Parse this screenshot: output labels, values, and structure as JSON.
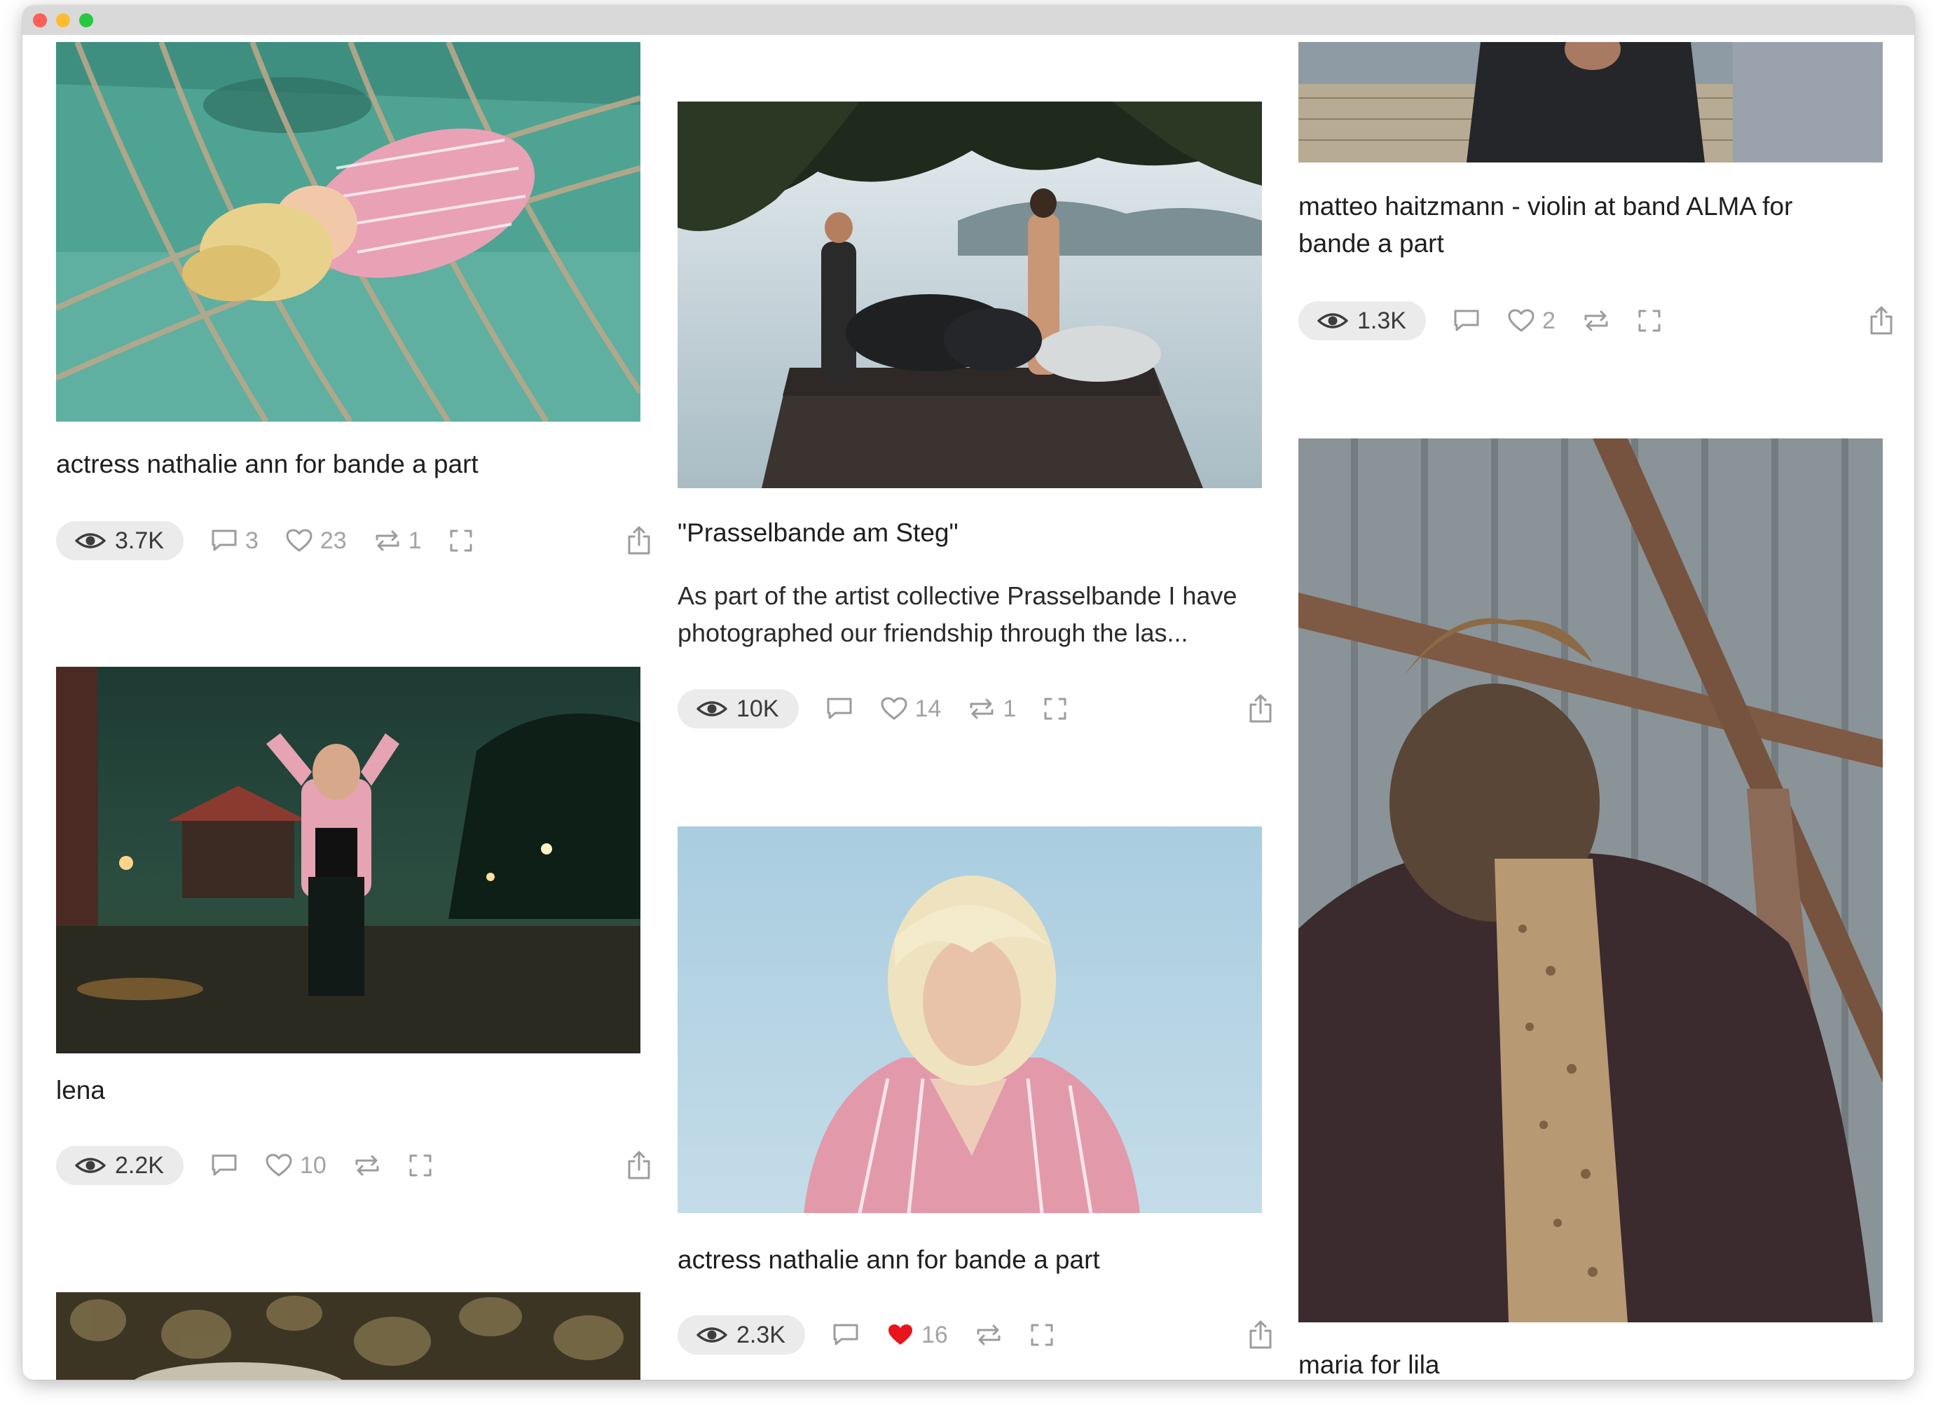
{
  "window": {
    "controls": [
      "close",
      "minimize",
      "zoom"
    ]
  },
  "cards": [
    {
      "id": "c1",
      "caption": "actress nathalie ann for bande a part",
      "views": "3.7K",
      "comments": "3",
      "likes": "23",
      "reposts": "1",
      "liked": false
    },
    {
      "id": "c2",
      "caption": "lena",
      "views": "2.2K",
      "comments": "",
      "likes": "10",
      "reposts": "",
      "liked": false
    },
    {
      "id": "c3",
      "caption": "\"Prasselbande am Steg\"",
      "description_line1": "As part of the artist collective Prasselbande I have",
      "description_line2": "photographed our friendship through the las...",
      "views": "10K",
      "comments": "",
      "likes": "14",
      "reposts": "1",
      "liked": false
    },
    {
      "id": "c4",
      "caption": "actress nathalie ann for bande a part",
      "views": "2.3K",
      "comments": "",
      "likes": "16",
      "reposts": "",
      "liked": true
    },
    {
      "id": "c5",
      "caption_line1": "matteo haitzmann - violin at band ALMA for",
      "caption_line2": "bande a part",
      "views": "1.3K",
      "comments": "",
      "likes": "2",
      "reposts": "",
      "liked": false
    },
    {
      "id": "c6",
      "caption": "maria for lila"
    }
  ],
  "icons": {
    "views": "eye-icon",
    "comments": "comment-icon",
    "likes": "heart-icon",
    "reposts": "repost-icon",
    "fullscreen": "fullscreen-icon",
    "share": "share-icon"
  },
  "colors": {
    "liked_heart": "#e8151b",
    "pill_bg": "#ebebeb",
    "icon_gray": "#9c9c9c"
  }
}
